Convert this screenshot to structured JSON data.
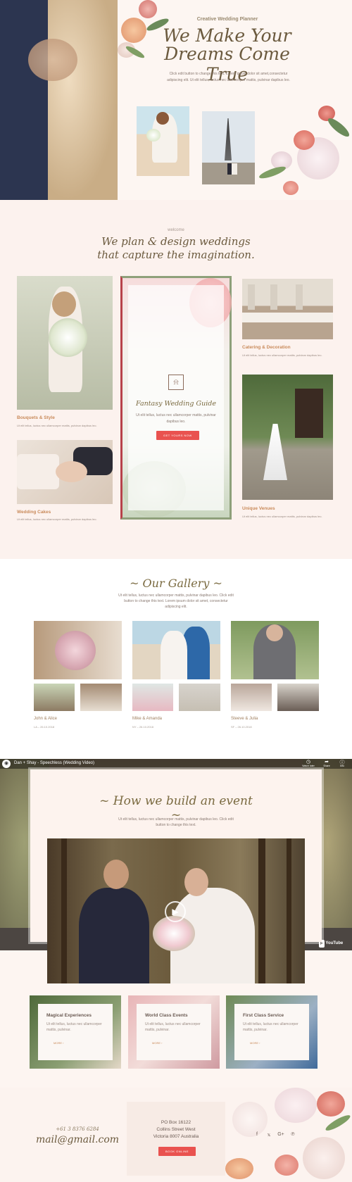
{
  "hero": {
    "eyebrow": "Creative Wedding Planner",
    "title_line1": "We Make Your",
    "title_line2": "Dreams Come True",
    "text": "Click edit button to change this text. Lorem ipsum dolor sit amet,consectetur adipiscing elit. Ut elit tellus, luctus nec ullamcorper mattis, pulvinar dapibus leo."
  },
  "welcome": {
    "eyebrow": "welcome",
    "title_line1": "We plan & design weddings",
    "title_line2": "that capture the imagination."
  },
  "services": {
    "left": [
      {
        "title": "Bouquets & Style",
        "text": "Ut elit tellus, luctus nec ullamcorper mattis, pulvinar dapibus leo."
      },
      {
        "title": "Wedding Cakes",
        "text": "Ut elit tellus, luctus nec ullamcorper mattis, pulvinar dapibus leo."
      }
    ],
    "right": [
      {
        "title": "Catering & Decoration",
        "text": "Ut elit tellus, luctus nec ullamcorper mattis, pulvinar dapibus leo."
      },
      {
        "title": "Unique Venues",
        "text": "Ut elit tellus, luctus nec ullamcorper mattis, pulvinar dapibus leo."
      }
    ],
    "guide": {
      "title": "Fantasy Wedding Guide",
      "text": "Ut elit tellus, luctus nec ullamcorper mattis, pulvinar dapibus leo.",
      "button": "GET YOURS NOW"
    }
  },
  "gallery": {
    "title": "~ Our Gallery ~",
    "text": "Ut elit tellus, luctus nec ullamcorper mattis, pulvinar dapibus leo. Click edit button to change this text. Lorem ipsum dolor sit amet, consectetur adipiscing elit.",
    "items": [
      {
        "name": "John & Alice",
        "date": "LA – 26.10.2018"
      },
      {
        "name": "Mike & Amanda",
        "date": "NY – 26.10.2018"
      },
      {
        "name": "Steeve & Julia",
        "date": "SF – 26.10.2018"
      }
    ]
  },
  "video": {
    "title": "Dan + Shay - Speechless (Wedding Video)",
    "watch_later": "Watch later",
    "share": "Share",
    "info": "Info",
    "youtube": "YouTube"
  },
  "build": {
    "title": "~ How we build an event ~",
    "text": "Ut elit tellus, luctus nec ullamcorper mattis, pulvinar dapibus leo. Click edit button to change this text."
  },
  "features": [
    {
      "title": "Magical Experiences",
      "text": "Ut elit tellus, luctus nec ullamcorper mattis, pulvinar.",
      "more": "MORE ›"
    },
    {
      "title": "World Class Events",
      "text": "Ut elit tellus, luctus nec ullamcorper mattis, pulvinar.",
      "more": "MORE ›"
    },
    {
      "title": "First Class Service",
      "text": "Ut elit tellus, luctus nec ullamcorper mattis, pulvinar.",
      "more": "MORE ›"
    }
  ],
  "contact": {
    "phone": "+61 3 8376 6284",
    "email": "mail@gmail.com",
    "address_line1": "PO Box 16122",
    "address_line2": "Collins Street West",
    "address_line3": "Victoria 8007 Australia",
    "button": "BOOK ONLINE",
    "social": {
      "facebook": "f",
      "twitter": "𝕩",
      "google": "G+",
      "pinterest": "℗"
    }
  }
}
